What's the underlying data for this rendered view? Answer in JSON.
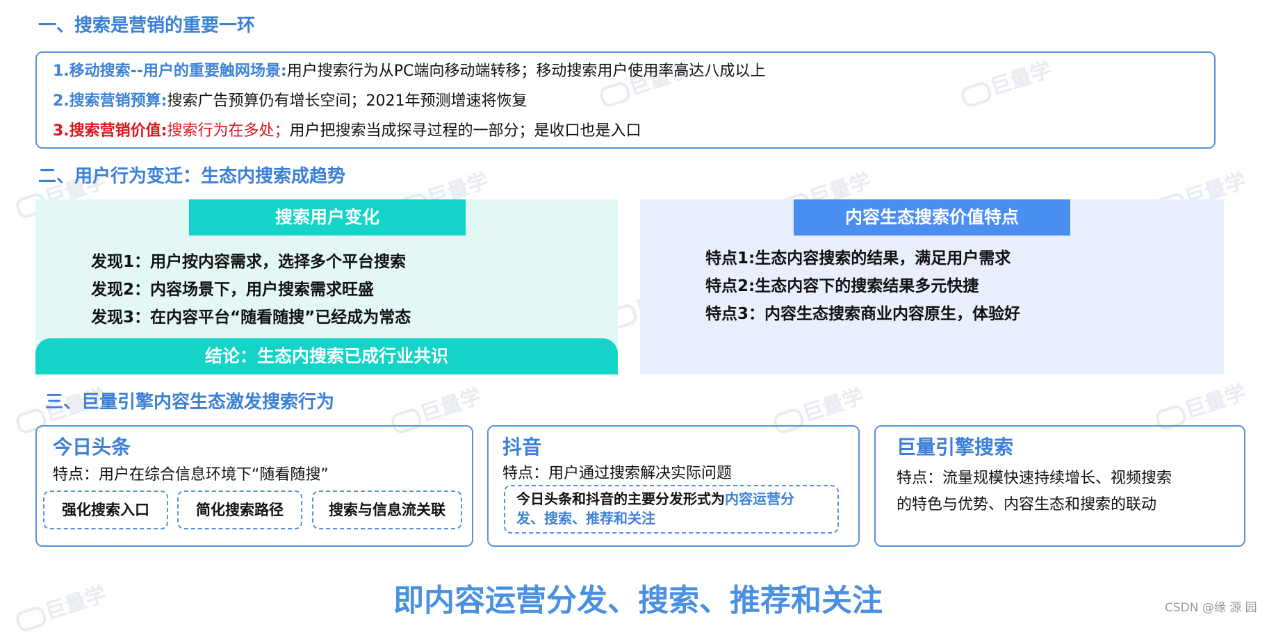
{
  "sections": [
    "一、搜索是营销的重要一环",
    "二、用户行为变迁：生态内搜索成趋势",
    "三、巨量引擎内容生态激发搜索行为"
  ],
  "section1": {
    "item1_label": "1.移动搜索--用户的重要触网场景:",
    "item1_text": "用户搜索行为从PC端向移动端转移；移动搜索用户使用率高达八成以上",
    "item2_label": "2.搜索营销预算:",
    "item2_text": "搜索广告预算仍有增长空间；2021年预测增速将恢复",
    "item3_label": "3.搜索营销价值:",
    "item3_red": "搜索行为在多处；",
    "item3_text": "用户把搜索当成探寻过程的一部分；是收口也是入口"
  },
  "section2": {
    "left_banner": "搜索用户变化",
    "findings": [
      "发现1：用户按内容需求，选择多个平台搜索",
      "发现2：内容场景下，用户搜索需求旺盛",
      "发现3：在内容平台“随看随搜”已经成为常态"
    ],
    "conclusion": "结论：生态内搜索已成行业共识",
    "right_banner": "内容生态搜索价值特点",
    "features": [
      "特点1:生态内容搜索的结果，满足用户需求",
      "特点2:生态内容下的搜索结果多元快捷",
      "特点3：内容生态搜索商业内容原生，体验好"
    ]
  },
  "section3": {
    "card1_title": "今日头条",
    "card1_text": "特点：用户在综合信息环境下“随看随搜”",
    "card1_pills": [
      "强化搜索入口",
      "简化搜索路径",
      "搜索与信息流关联"
    ],
    "card2_title": "抖音",
    "card2_text": "特点：用户通过搜索解决实际问题",
    "card2_pill_black": "今日头条和抖音的主要分发形式为",
    "card2_pill_blue1": "内容运营分",
    "card2_pill_blue2": "发、搜索、推荐和关注",
    "card3_title": "巨量引擎搜索",
    "card3_text1": "特点：流量规模快速持续增长、视频搜索",
    "card3_text2": "的特色与优势、内容生态和搜索的联动"
  },
  "footer": {
    "big_text": "即内容运营分发、搜索、推荐和关注",
    "credit": "CSDN @缘  源  园"
  },
  "watermark": "巨量学",
  "colors": {
    "title_blue": "#3b7fd6",
    "label_red": "#e0151b",
    "teal": "#14d4c8",
    "banner_blue": "#4a8ef2",
    "footer_blue": "#4a90e2"
  }
}
